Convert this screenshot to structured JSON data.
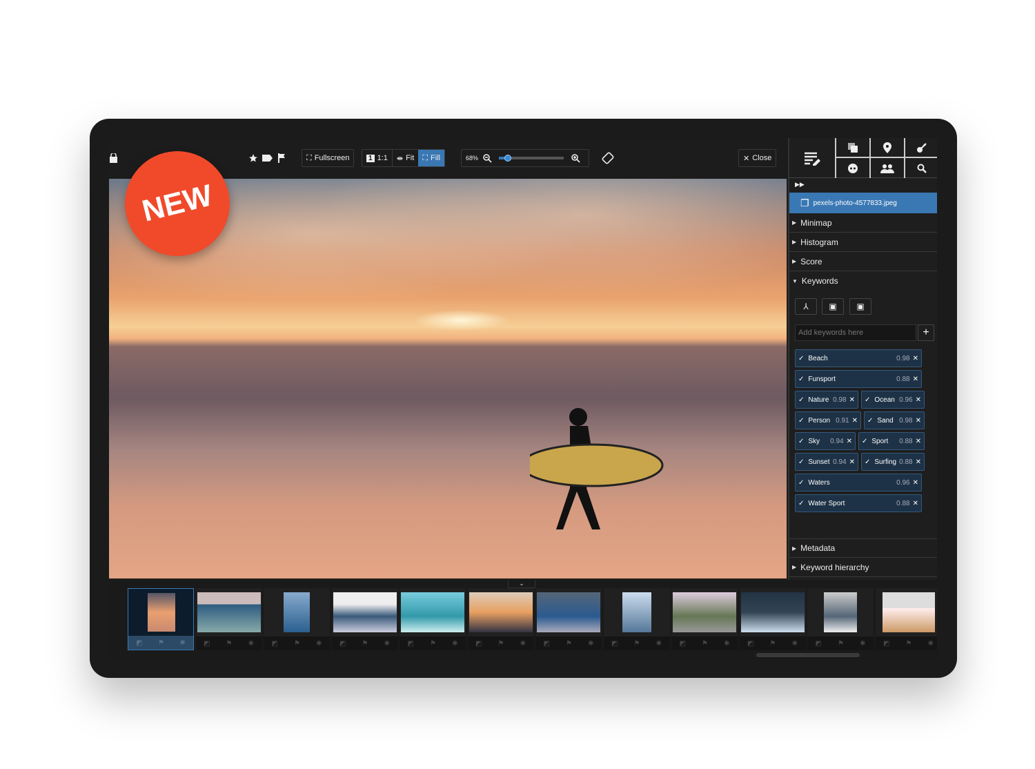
{
  "badge": "NEW",
  "toolbar": {
    "fullscreen": "Fullscreen",
    "one_to_one": "1:1",
    "one_icon": "1",
    "fit": "Fit",
    "fill": "Fill",
    "zoom": "68%",
    "zoom_level": 0.1,
    "close": "Close",
    "icons": [
      "lock-icon",
      "star-icon",
      "label-icon",
      "flag-icon",
      "rotate-icon"
    ]
  },
  "panel": {
    "tabs": [
      "edit-info-icon",
      "duplicates-icon",
      "location-icon",
      "key-icon",
      "face-icon",
      "people-icon",
      "search-icon"
    ],
    "filename": "pexels-photo-4577833.jpeg",
    "sections_top": [
      "Minimap",
      "Histogram",
      "Score"
    ],
    "keywords_title": "Keywords",
    "keyword_placeholder": "Add keywords here",
    "add": "+",
    "keywords": [
      {
        "label": "Beach",
        "score": "0.98"
      },
      {
        "label": "Funsport",
        "score": "0.88"
      },
      {
        "label": "Nature",
        "score": "0.98"
      },
      {
        "label": "Ocean",
        "score": "0.96"
      },
      {
        "label": "Person",
        "score": "0.91"
      },
      {
        "label": "Sand",
        "score": "0.98"
      },
      {
        "label": "Sky",
        "score": "0.94"
      },
      {
        "label": "Sport",
        "score": "0.88"
      },
      {
        "label": "Sunset",
        "score": "0.94"
      },
      {
        "label": "Surfing",
        "score": "0.88"
      },
      {
        "label": "Waters",
        "score": "0.96"
      },
      {
        "label": "Water Sport",
        "score": "0.88"
      }
    ],
    "sections_bottom": [
      "Metadata",
      "Keyword hierarchy"
    ]
  },
  "colors": {
    "accent": "#3a78b4",
    "badge": "#f04a2b",
    "chip": "#1d3246"
  },
  "filmstrip": {
    "count": 12,
    "selected": 0
  }
}
